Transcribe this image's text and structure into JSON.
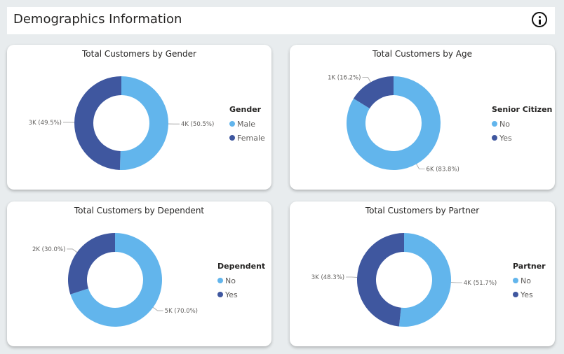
{
  "header": {
    "title": "Demographics Information",
    "info_icon": "info-icon"
  },
  "colors": {
    "light": "#62b5ec",
    "dark": "#3f579f"
  },
  "cards": [
    {
      "title": "Total Customers by Gender",
      "legend": {
        "title": "Gender",
        "items": [
          "Male",
          "Female"
        ]
      },
      "labels": [
        "4K (50.5%)",
        "3K (49.5%)"
      ]
    },
    {
      "title": "Total Customers by Age",
      "legend": {
        "title": "Senior Citizen",
        "items": [
          "No",
          "Yes"
        ]
      },
      "labels": [
        "6K (83.8%)",
        "1K (16.2%)"
      ]
    },
    {
      "title": "Total Customers by Dependent",
      "legend": {
        "title": "Dependent",
        "items": [
          "No",
          "Yes"
        ]
      },
      "labels": [
        "5K (70.0%)",
        "2K (30.0%)"
      ]
    },
    {
      "title": "Total Customers by Partner",
      "legend": {
        "title": "Partner",
        "items": [
          "No",
          "Yes"
        ]
      },
      "labels": [
        "4K (51.7%)",
        "3K (48.3%)"
      ]
    }
  ],
  "chart_data": [
    {
      "type": "pie",
      "title": "Total Customers by Gender",
      "legend_title": "Gender",
      "categories": [
        "Male",
        "Female"
      ],
      "values": [
        50.5,
        49.5
      ],
      "value_labels": [
        "4K",
        "3K"
      ],
      "unit": "%",
      "donut": true,
      "legend_position": "right"
    },
    {
      "type": "pie",
      "title": "Total Customers by Age",
      "legend_title": "Senior Citizen",
      "categories": [
        "No",
        "Yes"
      ],
      "values": [
        83.8,
        16.2
      ],
      "value_labels": [
        "6K",
        "1K"
      ],
      "unit": "%",
      "donut": true,
      "legend_position": "right"
    },
    {
      "type": "pie",
      "title": "Total Customers by Dependent",
      "legend_title": "Dependent",
      "categories": [
        "No",
        "Yes"
      ],
      "values": [
        70.0,
        30.0
      ],
      "value_labels": [
        "5K",
        "2K"
      ],
      "unit": "%",
      "donut": true,
      "legend_position": "right"
    },
    {
      "type": "pie",
      "title": "Total Customers by Partner",
      "legend_title": "Partner",
      "categories": [
        "No",
        "Yes"
      ],
      "values": [
        51.7,
        48.3
      ],
      "value_labels": [
        "4K",
        "3K"
      ],
      "unit": "%",
      "donut": true,
      "legend_position": "right"
    }
  ]
}
